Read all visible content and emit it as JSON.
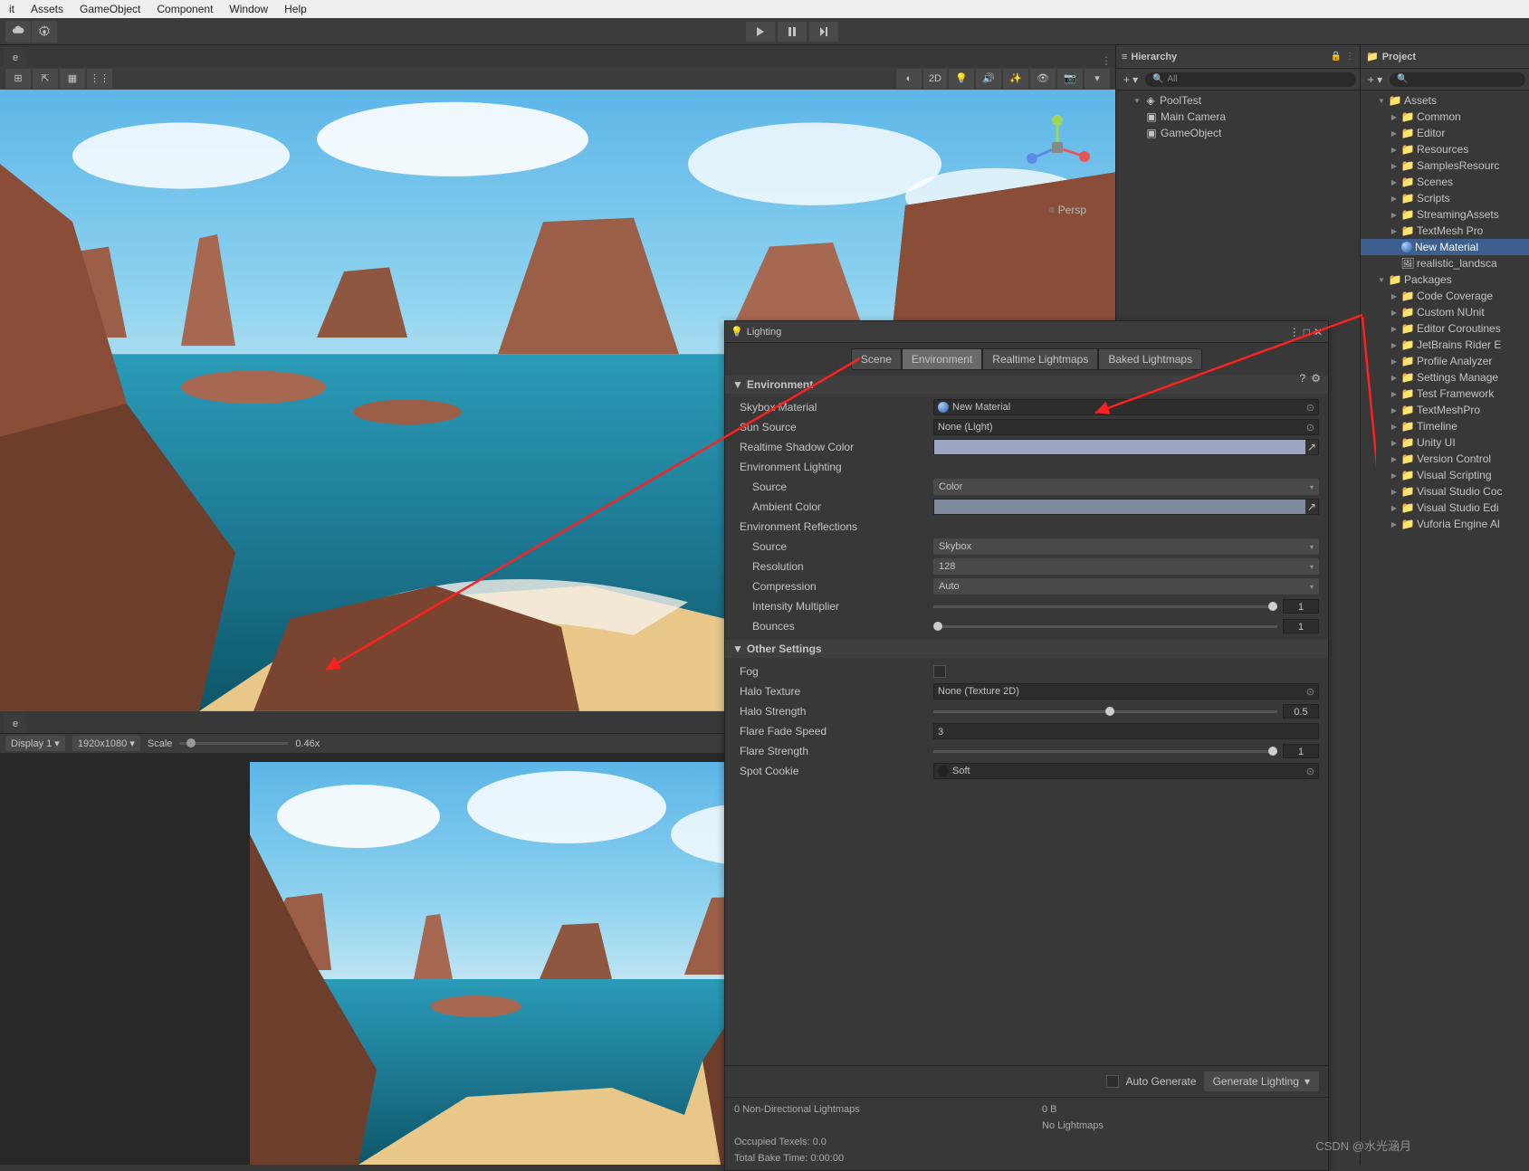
{
  "menu": {
    "items": [
      "it",
      "Assets",
      "GameObject",
      "Component",
      "Window",
      "Help"
    ]
  },
  "scene": {
    "tab_label": "e",
    "toolbar": {
      "mode_2d": "2D"
    },
    "persp": "Persp"
  },
  "game": {
    "tab_label": "e",
    "display": "Display 1",
    "resolution": "1920x1080",
    "scale_label": "Scale",
    "scale_value": "0.46x"
  },
  "hierarchy": {
    "title": "Hierarchy",
    "search_placeholder": "All",
    "root": "PoolTest",
    "items": [
      "Main Camera",
      "GameObject"
    ]
  },
  "project": {
    "title": "Project",
    "assets_root": "Assets",
    "assets": [
      "Common",
      "Editor",
      "Resources",
      "SamplesResourc",
      "Scenes",
      "Scripts",
      "StreamingAssets",
      "TextMesh Pro"
    ],
    "new_material": "New Material",
    "landscape": "realistic_landsca",
    "packages_root": "Packages",
    "packages": [
      "Code Coverage",
      "Custom NUnit",
      "Editor Coroutines",
      "JetBrains Rider E",
      "Profile Analyzer",
      "Settings Manage",
      "Test Framework",
      "TextMeshPro",
      "Timeline",
      "Unity UI",
      "Version Control",
      "Visual Scripting",
      "Visual Studio Coc",
      "Visual Studio Edi",
      "Vuforia Engine Al"
    ]
  },
  "lighting": {
    "title": "Lighting",
    "tabs": [
      "Scene",
      "Environment",
      "Realtime Lightmaps",
      "Baked Lightmaps"
    ],
    "section_env": "Environment",
    "skybox_label": "Skybox Material",
    "skybox_value": "New Material",
    "sun_label": "Sun Source",
    "sun_value": "None (Light)",
    "realtime_shadow_label": "Realtime Shadow Color",
    "env_lighting_label": "Environment Lighting",
    "el_source_label": "Source",
    "el_source_value": "Color",
    "ambient_label": "Ambient Color",
    "env_refl_label": "Environment Reflections",
    "er_source_label": "Source",
    "er_source_value": "Skybox",
    "resolution_label": "Resolution",
    "resolution_value": "128",
    "compression_label": "Compression",
    "compression_value": "Auto",
    "intensity_label": "Intensity Multiplier",
    "intensity_value": "1",
    "bounces_label": "Bounces",
    "bounces_value": "1",
    "section_other": "Other Settings",
    "fog_label": "Fog",
    "halo_tex_label": "Halo Texture",
    "halo_tex_value": "None (Texture 2D)",
    "halo_str_label": "Halo Strength",
    "halo_str_value": "0.5",
    "flare_fade_label": "Flare Fade Speed",
    "flare_fade_value": "3",
    "flare_str_label": "Flare Strength",
    "flare_str_value": "1",
    "spot_cookie_label": "Spot Cookie",
    "spot_cookie_value": "Soft",
    "auto_gen_label": "Auto Generate",
    "gen_btn": "Generate Lighting",
    "stat_lightmaps": "0 Non-Directional Lightmaps",
    "stat_size": "0 B",
    "stat_no_lightmaps": "No Lightmaps",
    "stat_texels": "Occupied Texels: 0.0",
    "stat_bake": "Total Bake Time: 0:00:00"
  },
  "watermark": "CSDN @水光涵月"
}
